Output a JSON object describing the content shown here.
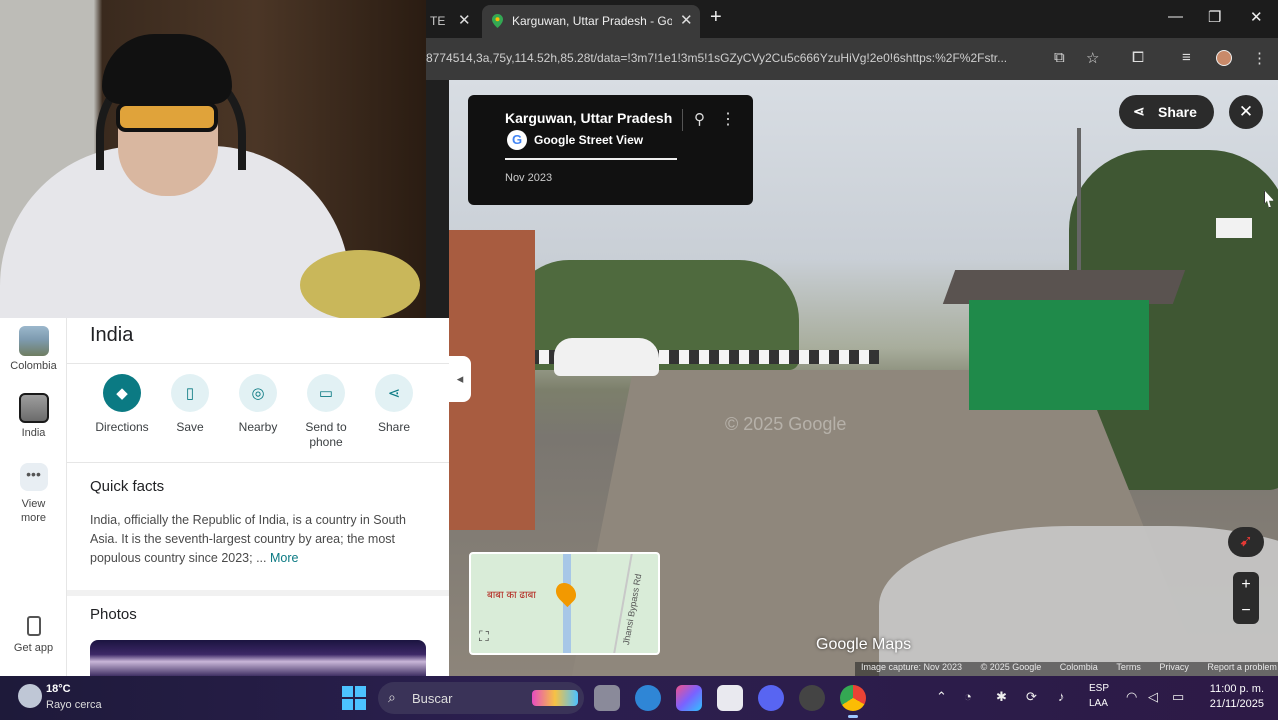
{
  "browser": {
    "prev_tab_label": "TE",
    "active_tab_label": "Karguwan, Uttar Pradesh - Goo",
    "url": "8774514,3a,75y,114.52h,85.28t/data=!3m7!1e1!3m5!1sGZyCVy2Cu5c666YzuHiVg!2e0!6shttps:%2F%2Fstr..."
  },
  "rail": {
    "items": [
      {
        "label": "Colombia"
      },
      {
        "label": "India"
      },
      {
        "label": "View more",
        "dots": "•••"
      },
      {
        "label": "Get app"
      }
    ]
  },
  "panel": {
    "title": "India",
    "actions": [
      {
        "label": "Directions",
        "icon": "◆"
      },
      {
        "label": "Save",
        "icon": "▯"
      },
      {
        "label": "Nearby",
        "icon": "◎"
      },
      {
        "label": "Send to phone",
        "icon": "▭"
      },
      {
        "label": "Share",
        "icon": "⋖"
      }
    ],
    "quick_facts_title": "Quick facts",
    "quick_facts_body": "India, officially the Republic of India, is a country in South Asia. It is the seventh-largest country by area; the most populous country since 2023; ...",
    "quick_facts_more": "More",
    "photos_title": "Photos"
  },
  "streetview": {
    "place_title": "Karguwan, Uttar Pradesh",
    "source": "Google Street View",
    "date": "Nov 2023",
    "share_label": "Share",
    "close_symbol": "✕",
    "watermark": "© 2025 Google",
    "minimap_label": "बाबा का ढाबा",
    "minimap_road": "Jhansi Bypass Rd",
    "brand": "Google Maps",
    "attribution": [
      "Image capture: Nov 2023",
      "© 2025 Google",
      "Colombia",
      "Terms",
      "Privacy",
      "Report a problem"
    ]
  },
  "taskbar": {
    "temp": "18°C",
    "weather_desc": "Rayo cerca",
    "search_label": "Buscar",
    "lang_top": "ESP",
    "lang_bottom": "LAA",
    "time": "11:00 p. m.",
    "date": "21/11/2025"
  }
}
